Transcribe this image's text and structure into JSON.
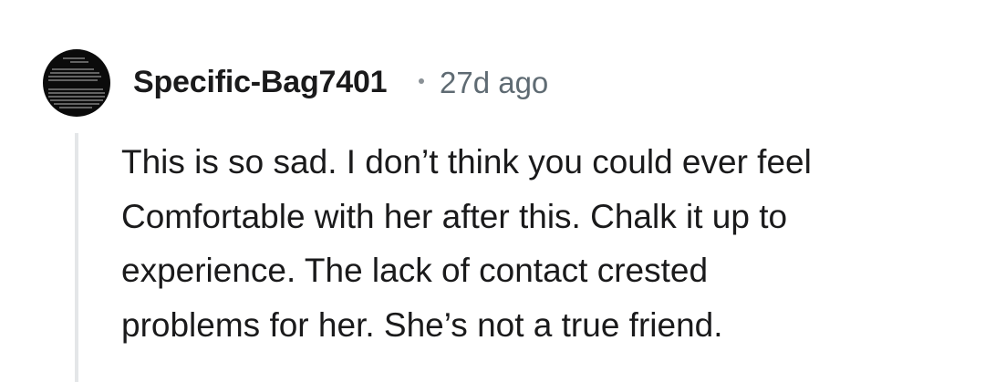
{
  "comment": {
    "avatar_icon": "user-avatar-icon",
    "username": "Specific-Bag7401",
    "separator": "•",
    "age": "27d ago",
    "body_lines": [
      "This is so sad. I don’t think you could ever feel",
      "Comfortable with her after this. Chalk it up to",
      "experience. The lack of contact crested",
      "problems for her. She’s not a true friend."
    ]
  },
  "colors": {
    "text": "#1a1a1b",
    "meta": "#5f6b73",
    "thread_line": "#e4e6e8",
    "avatar_bg": "#0b0b0b"
  }
}
